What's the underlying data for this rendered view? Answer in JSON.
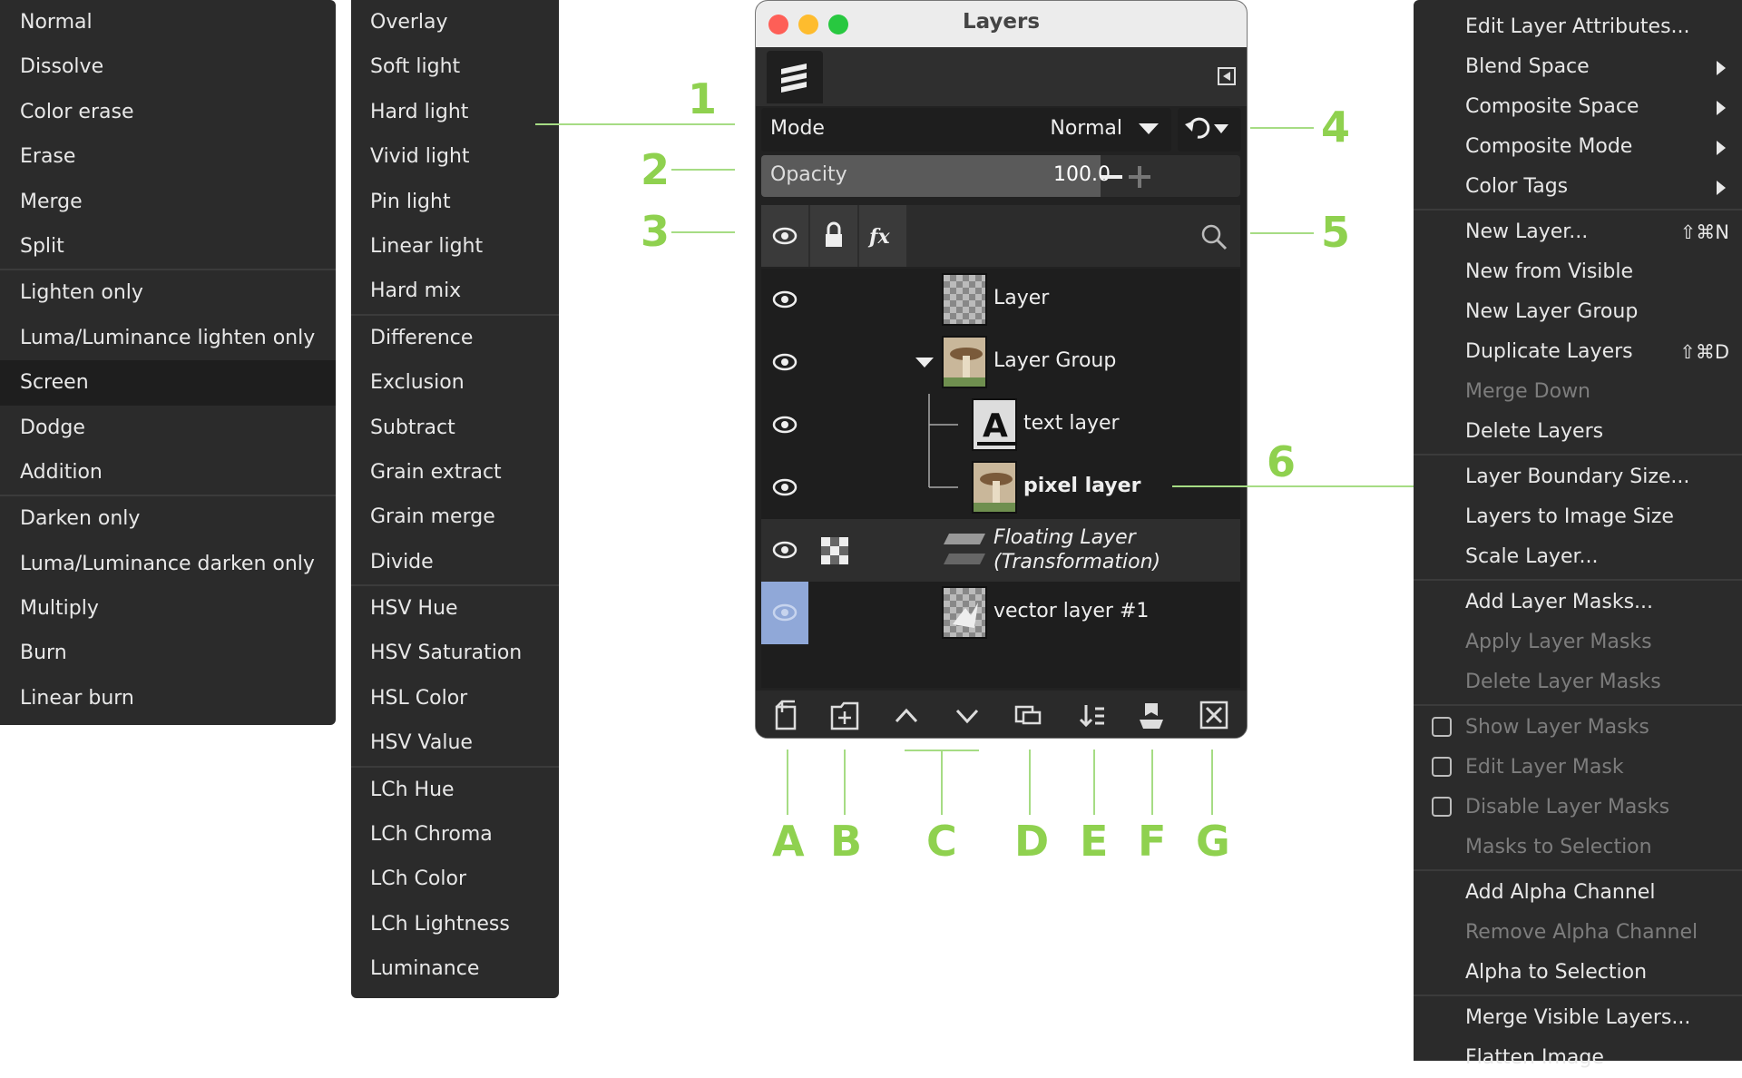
{
  "blend_menu_1": {
    "groups": [
      [
        "Normal",
        "Dissolve",
        "Color erase",
        "Erase",
        "Merge",
        "Split"
      ],
      [
        "Lighten only",
        "Luma/Luminance lighten only",
        "Screen",
        "Dodge",
        "Addition"
      ],
      [
        "Darken only",
        "Luma/Luminance darken only",
        "Multiply",
        "Burn",
        "Linear burn"
      ]
    ],
    "selected": "Screen"
  },
  "blend_menu_2": {
    "groups": [
      [
        "Overlay",
        "Soft light",
        "Hard light",
        "Vivid light",
        "Pin light",
        "Linear light",
        "Hard mix"
      ],
      [
        "Difference",
        "Exclusion",
        "Subtract",
        "Grain extract",
        "Grain merge",
        "Divide"
      ],
      [
        "HSV Hue",
        "HSV Saturation",
        "HSL Color",
        "HSV Value"
      ],
      [
        "LCh Hue",
        "LCh Chroma",
        "LCh Color",
        "LCh Lightness",
        "Luminance"
      ]
    ]
  },
  "layers_window": {
    "title": "Layers",
    "mode_label": "Mode",
    "mode_value": "Normal",
    "opacity_label": "Opacity",
    "opacity_value": "100.0",
    "opacity_fraction": 1.0,
    "layers": [
      {
        "name": "Layer",
        "thumb": "checker"
      },
      {
        "name": "Layer Group",
        "thumb": "photo"
      },
      {
        "name": "text layer",
        "thumb": "text"
      },
      {
        "name": "pixel layer",
        "thumb": "photo"
      },
      {
        "name": "Floating Layer",
        "name2": "(Transformation)",
        "thumb": "floating"
      },
      {
        "name": "vector layer #1",
        "thumb": "vector"
      }
    ]
  },
  "callouts": {
    "numbers": [
      "1",
      "2",
      "3",
      "4",
      "5",
      "6"
    ],
    "letters": [
      "A",
      "B",
      "C",
      "D",
      "E",
      "F",
      "G"
    ]
  },
  "context_menu": {
    "items": [
      {
        "label": "Edit Layer Attributes...",
        "enabled": true
      },
      {
        "label": "Blend Space",
        "enabled": true,
        "submenu": true
      },
      {
        "label": "Composite Space",
        "enabled": true,
        "submenu": true
      },
      {
        "label": "Composite Mode",
        "enabled": true,
        "submenu": true
      },
      {
        "label": "Color Tags",
        "enabled": true,
        "submenu": true
      },
      {
        "sep": true
      },
      {
        "label": "New Layer...",
        "enabled": true,
        "shortcut": "⇧⌘N"
      },
      {
        "label": "New from Visible",
        "enabled": true
      },
      {
        "label": "New Layer Group",
        "enabled": true
      },
      {
        "label": "Duplicate Layers",
        "enabled": true,
        "shortcut": "⇧⌘D"
      },
      {
        "label": "Merge Down",
        "enabled": false
      },
      {
        "label": "Delete Layers",
        "enabled": true
      },
      {
        "sep": true
      },
      {
        "label": "Layer Boundary Size...",
        "enabled": true
      },
      {
        "label": "Layers to Image Size",
        "enabled": true
      },
      {
        "label": "Scale Layer...",
        "enabled": true
      },
      {
        "sep": true
      },
      {
        "label": "Add Layer Masks...",
        "enabled": true
      },
      {
        "label": "Apply Layer Masks",
        "enabled": false
      },
      {
        "label": "Delete Layer Masks",
        "enabled": false
      },
      {
        "sep": true
      },
      {
        "label": "Show Layer Masks",
        "enabled": false,
        "checkbox": true
      },
      {
        "label": "Edit Layer Mask",
        "enabled": false,
        "checkbox": true
      },
      {
        "label": "Disable Layer Masks",
        "enabled": false,
        "checkbox": true
      },
      {
        "label": "Masks to Selection",
        "enabled": false
      },
      {
        "sep": true
      },
      {
        "label": "Add Alpha Channel",
        "enabled": true
      },
      {
        "label": "Remove Alpha Channel",
        "enabled": false
      },
      {
        "label": "Alpha to Selection",
        "enabled": true
      },
      {
        "sep": true
      },
      {
        "label": "Merge Visible Layers...",
        "enabled": true
      },
      {
        "label": "Flatten Image",
        "enabled": true
      }
    ]
  },
  "colors": {
    "accent_green": "#8fd14f",
    "menu_bg": "#2b2b2b",
    "selected_row": "#1e1e1e",
    "active_eye": "#90a8d8"
  }
}
